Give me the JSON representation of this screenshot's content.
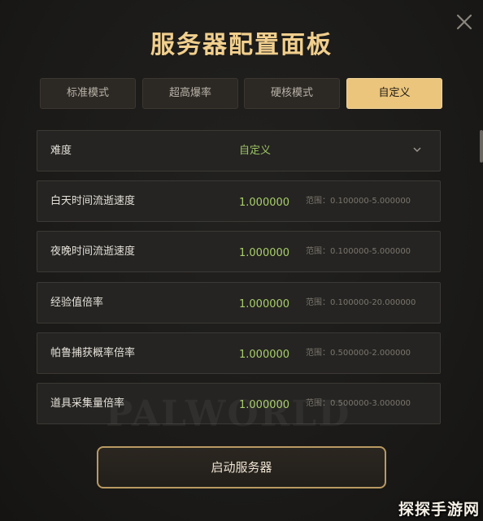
{
  "title": "服务器配置面板",
  "tabs": [
    {
      "label": "标准模式",
      "active": false
    },
    {
      "label": "超高爆率",
      "active": false
    },
    {
      "label": "硬核模式",
      "active": false
    },
    {
      "label": "自定义",
      "active": true
    }
  ],
  "difficulty": {
    "label": "难度",
    "value": "自定义",
    "icon": "chevron-down-icon"
  },
  "settings": [
    {
      "label": "白天时间流逝速度",
      "value": "1.000000",
      "range": "范围：0.100000-5.000000"
    },
    {
      "label": "夜晚时间流逝速度",
      "value": "1.000000",
      "range": "范围：0.100000-5.000000"
    },
    {
      "label": "经验值倍率",
      "value": "1.000000",
      "range": "范围：0.100000-20.000000"
    },
    {
      "label": "帕鲁捕获概率倍率",
      "value": "1.000000",
      "range": "范围：0.500000-2.000000"
    },
    {
      "label": "道具采集量倍率",
      "value": "1.000000",
      "range": "范围：0.500000-3.000000"
    }
  ],
  "watermark": "PALWORLD",
  "start_button": "启动服务器",
  "corner_logo": "探探手游网",
  "icons": {
    "close": "close-icon",
    "chevron": "chevron-down-icon"
  },
  "colors": {
    "title": "#f1cf8d",
    "active_tab": "#ebc57c",
    "value_green": "#a8cf6a",
    "button_border": "#b99a62"
  }
}
